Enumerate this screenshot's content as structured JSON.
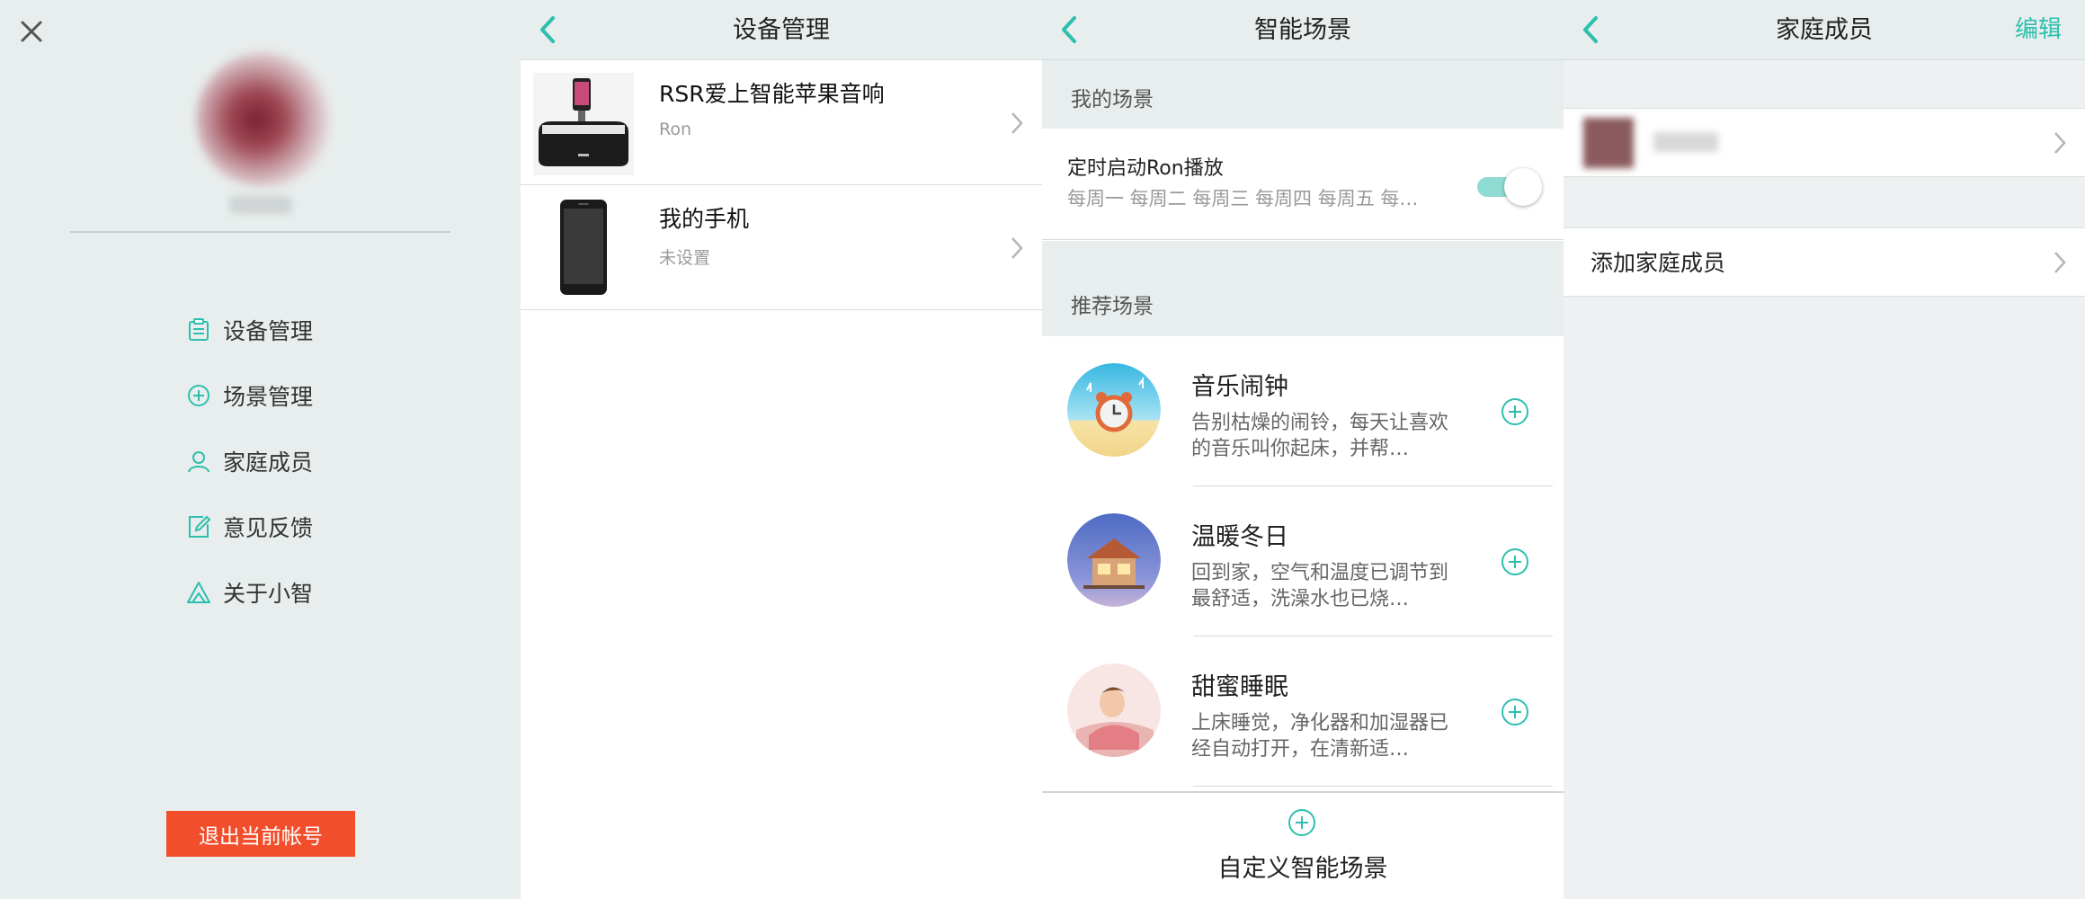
{
  "side_menu": {
    "items": [
      {
        "label": "设备管理",
        "icon": "clipboard-icon"
      },
      {
        "label": "场景管理",
        "icon": "plus-circle-icon"
      },
      {
        "label": "家庭成员",
        "icon": "user-icon"
      },
      {
        "label": "意见反馈",
        "icon": "edit-icon"
      },
      {
        "label": "关于小智",
        "icon": "triangle-logo-icon"
      }
    ],
    "logout_label": "退出当前帐号"
  },
  "devices": {
    "title": "设备管理",
    "items": [
      {
        "name": "RSR爱上智能苹果音响",
        "sub": "Ron"
      },
      {
        "name": "我的手机",
        "sub": "未设置"
      }
    ]
  },
  "scenes": {
    "title": "智能场景",
    "my_header": "我的场景",
    "my_scene": {
      "title": "定时启动Ron播放",
      "sub": "每周一 每周二 每周三 每周四 每周五 每…",
      "enabled": true
    },
    "rec_header": "推荐场景",
    "recommended": [
      {
        "title": "音乐闹钟",
        "desc": "告别枯燥的闹铃，每天让喜欢的音乐叫你起床，并帮…"
      },
      {
        "title": "温暖冬日",
        "desc": "回到家，空气和温度已调节到最舒适，洗澡水也已烧…"
      },
      {
        "title": "甜蜜睡眠",
        "desc": "上床睡觉，净化器和加湿器已经自动打开，在清新适…"
      }
    ],
    "custom_label": "自定义智能场景"
  },
  "family": {
    "title": "家庭成员",
    "edit_label": "编辑",
    "add_label": "添加家庭成员"
  },
  "colors": {
    "accent": "#2dbfae",
    "logout": "#f24e2b",
    "toggle_on": "#8fdcd2"
  }
}
